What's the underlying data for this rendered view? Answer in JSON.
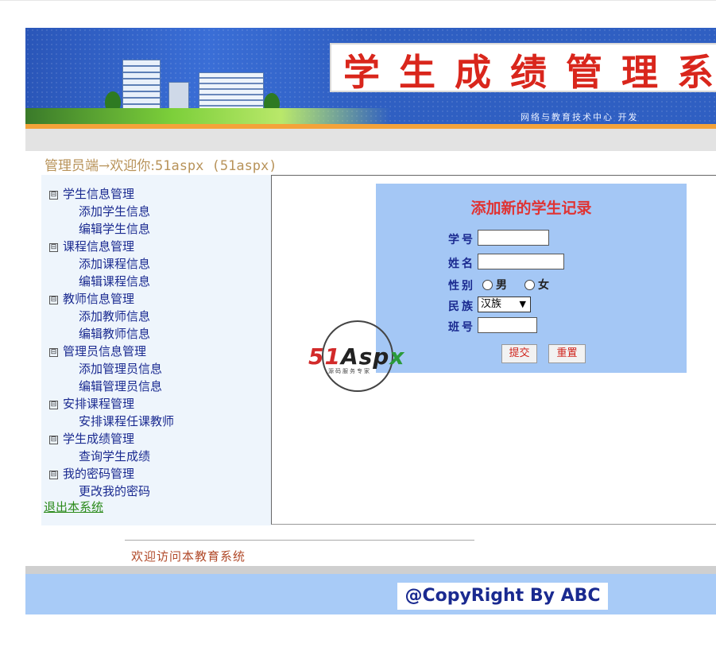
{
  "header": {
    "title": "学生成绩管理系统",
    "subtitle": "网络与教育技术中心 开发"
  },
  "welcome": {
    "role_text": "管理员端→欢迎你:",
    "user_text": "51aspx (51aspx)"
  },
  "sidebar": {
    "groups": [
      {
        "label": "学生信息管理",
        "items": [
          "添加学生信息",
          "编辑学生信息"
        ]
      },
      {
        "label": "课程信息管理",
        "items": [
          "添加课程信息",
          "编辑课程信息"
        ]
      },
      {
        "label": "教师信息管理",
        "items": [
          "添加教师信息",
          "编辑教师信息"
        ]
      },
      {
        "label": "管理员信息管理",
        "items": [
          "添加管理员信息",
          "编辑管理员信息"
        ]
      },
      {
        "label": "安排课程管理",
        "items": [
          "安排课程任课教师"
        ]
      },
      {
        "label": "学生成绩管理",
        "items": [
          "查询学生成绩"
        ]
      },
      {
        "label": "我的密码管理",
        "items": [
          "更改我的密码"
        ]
      }
    ],
    "collapse_glyph": "⊟",
    "logout": "退出本系统"
  },
  "form": {
    "title": "添加新的学生记录",
    "fields": {
      "student_id": {
        "label": "学号",
        "value": ""
      },
      "name": {
        "label": "姓名",
        "value": ""
      },
      "gender": {
        "label": "性别",
        "options": [
          "男",
          "女"
        ]
      },
      "ethnicity": {
        "label": "民族",
        "value": "汉族"
      },
      "class": {
        "label": "班号",
        "value": ""
      }
    },
    "submit_label": "提交",
    "reset_label": "重置"
  },
  "watermark": {
    "brand_red": "51",
    "brand_dark": "Asp",
    "brand_green": "x",
    "tagline": "源码服务专家"
  },
  "footer": {
    "welcome": "欢迎访问本教育系统",
    "copyright": "@CopyRight By ABC"
  },
  "colors": {
    "banner_blue": "#2f5fc2",
    "accent_orange": "#f4a33a",
    "form_bg": "#a4c7f5",
    "title_red": "#d9261c",
    "menu_text": "#1a2a90"
  }
}
